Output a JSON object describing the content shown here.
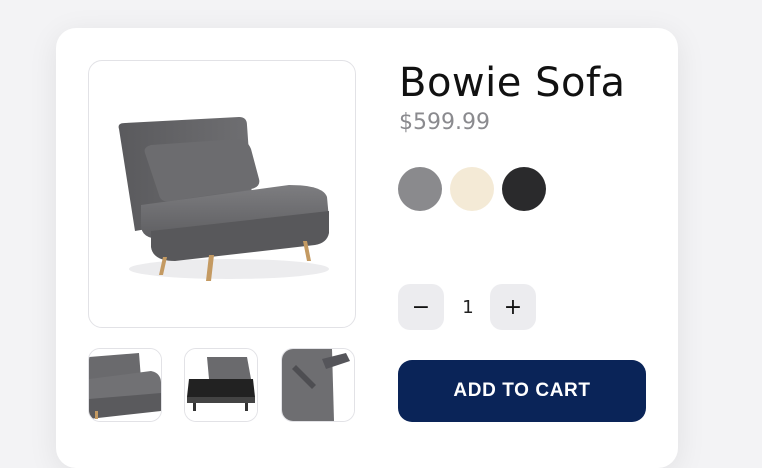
{
  "product": {
    "title": "Bowie Sofa",
    "price": "$599.99",
    "main_image": "sofa-bed-chair-gray-image",
    "thumbnails": [
      "sofa-closeup-thumbnail",
      "sofa-bed-unfolded-thumbnail",
      "sofa-side-fold-thumbnail"
    ],
    "swatches": [
      {
        "name": "gray",
        "color": "#8a8a8d"
      },
      {
        "name": "cream",
        "color": "#f4ead6"
      },
      {
        "name": "black",
        "color": "#2a2a2c"
      }
    ],
    "quantity": {
      "decrement_symbol": "−",
      "value": "1",
      "increment_symbol": "+"
    },
    "add_to_cart_label": "ADD TO CART"
  },
  "colors": {
    "accent": "#0a2458",
    "price": "#8a8a8e"
  }
}
